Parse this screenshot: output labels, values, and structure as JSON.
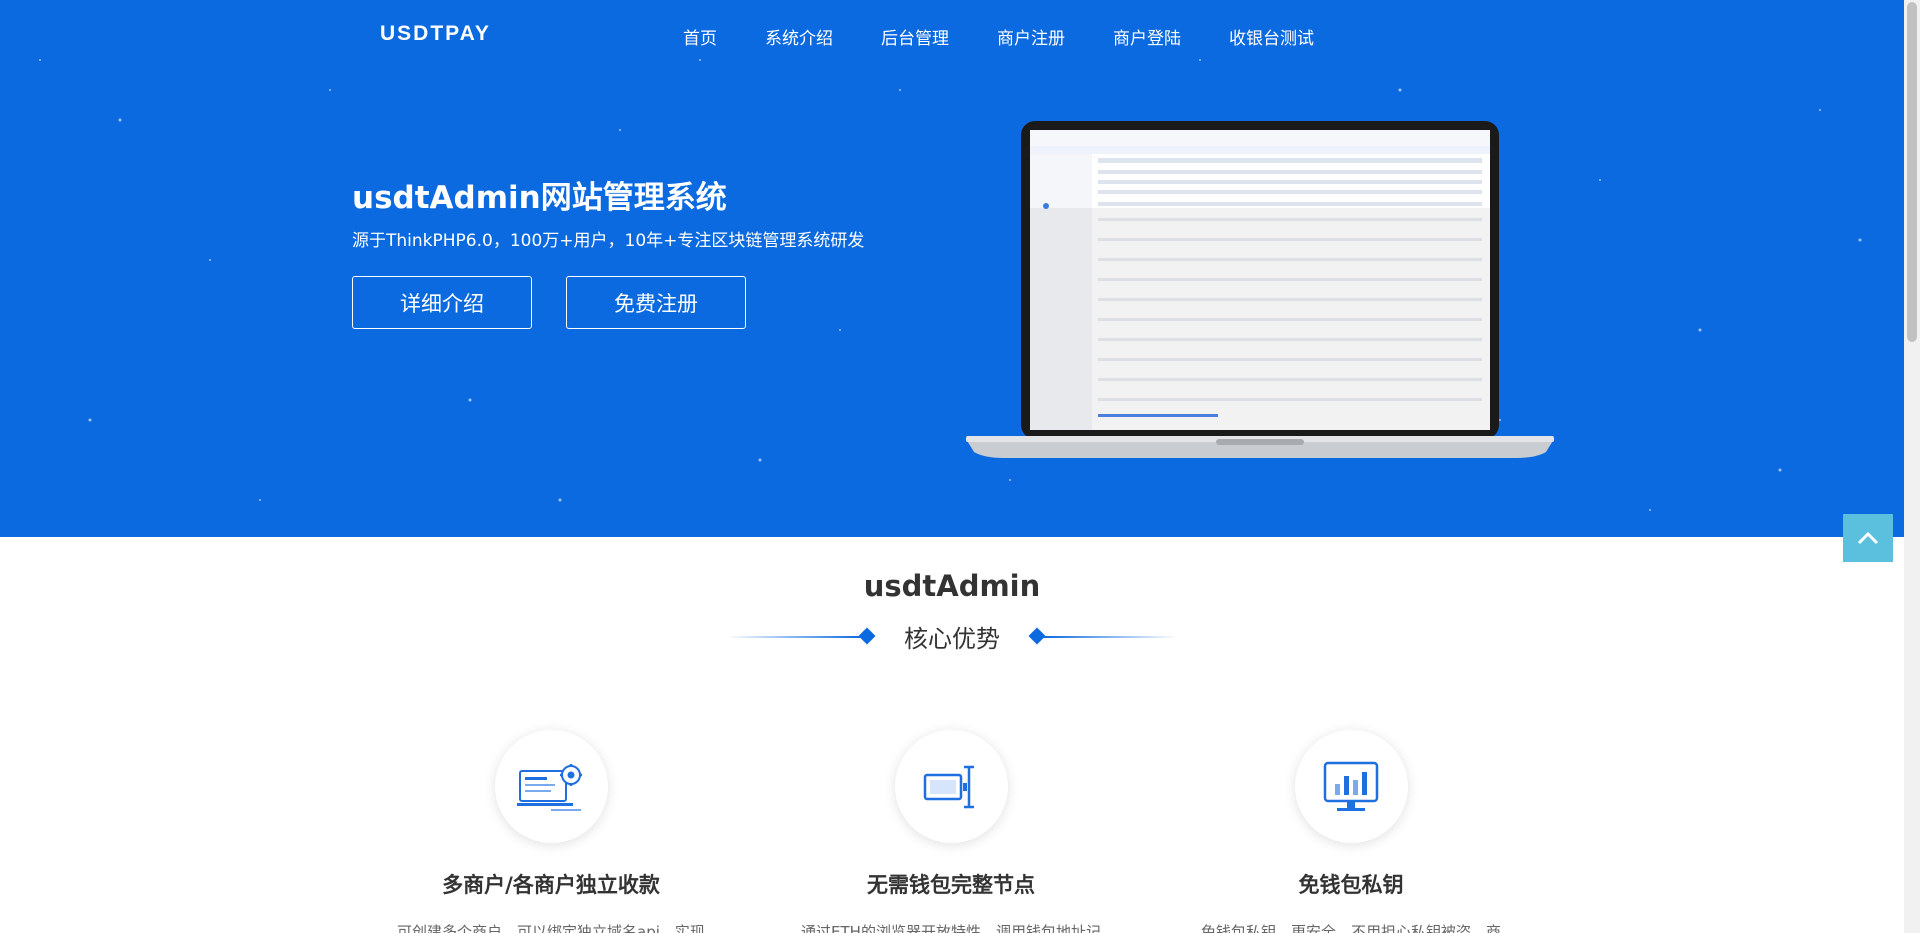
{
  "header": {
    "logo": "USDTPAY",
    "nav": [
      {
        "label": "首页"
      },
      {
        "label": "系统介绍"
      },
      {
        "label": "后台管理"
      },
      {
        "label": "商户注册"
      },
      {
        "label": "商户登陆"
      },
      {
        "label": "收银台测试"
      }
    ]
  },
  "hero": {
    "title": "usdtAdmin网站管理系统",
    "subtitle": "源于ThinkPHP6.0，100万+用户，10年+专注区块链管理系统研发",
    "btn_detail": "详细介绍",
    "btn_register": "免费注册"
  },
  "section": {
    "title": "usdtAdmin",
    "subtitle": "核心优势"
  },
  "features": [
    {
      "icon": "settings-screen-icon",
      "title": "多商户/各商户独立收款",
      "text": "可创建多个商户，可以绑定独立域名api，实现"
    },
    {
      "icon": "wallet-node-icon",
      "title": "无需钱包完整节点",
      "text": "通过ETH的浏览器开放特性，调用钱包地址记"
    },
    {
      "icon": "monitor-chart-icon",
      "title": "免钱包私钥",
      "text": "免钱包私钥，更安全，不用担心私钥被盗，商"
    }
  ],
  "colors": {
    "hero_bg": "#0c6ae0",
    "accent": "#0c6ae0",
    "totop_bg": "#5bc0de"
  }
}
